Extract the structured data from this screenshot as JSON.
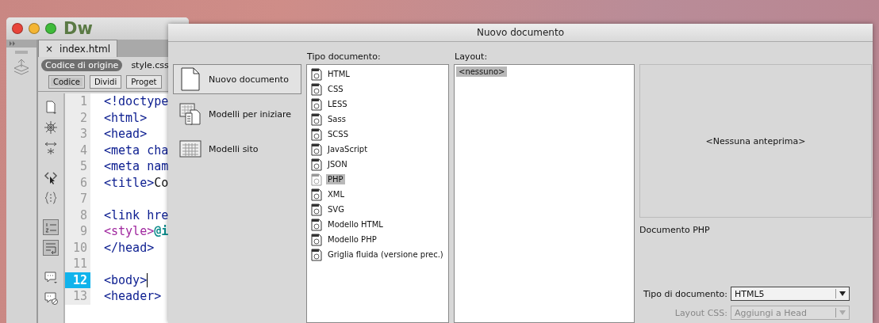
{
  "app": {
    "logo": "Dw",
    "tabs": [
      {
        "label": "index.html",
        "close": "×",
        "selected": true
      }
    ],
    "related_files": [
      {
        "label": "Codice di origine",
        "selected": true
      },
      {
        "label": "style.css",
        "selected": false
      }
    ],
    "view_buttons": [
      {
        "label": "Codice",
        "selected": true
      },
      {
        "label": "Dividi",
        "selected": false
      },
      {
        "label": "Proget",
        "selected": false
      }
    ],
    "code_toolbar": [
      [
        {
          "kind": "file",
          "on": false
        },
        {
          "kind": "web",
          "on": false
        },
        {
          "kind": "expand",
          "on": false
        }
      ],
      [
        {
          "kind": "tag",
          "on": false
        },
        {
          "kind": "braces",
          "on": false
        }
      ],
      [
        {
          "kind": "numbers",
          "on": true
        },
        {
          "kind": "wrap",
          "on": true
        }
      ],
      [
        {
          "kind": "comment",
          "on": false
        },
        {
          "kind": "uncomment",
          "on": false
        }
      ]
    ],
    "code_lines": [
      {
        "number": "1",
        "current": false,
        "segments": [
          {
            "kind": "tag",
            "text": "<!doctype"
          }
        ]
      },
      {
        "number": "2",
        "current": false,
        "segments": [
          {
            "kind": "tag",
            "text": "<html>"
          }
        ]
      },
      {
        "number": "3",
        "current": false,
        "segments": [
          {
            "kind": "tag",
            "text": "<head>"
          }
        ]
      },
      {
        "number": "4",
        "current": false,
        "segments": [
          {
            "kind": "tag",
            "text": "<meta cha"
          }
        ]
      },
      {
        "number": "5",
        "current": false,
        "segments": [
          {
            "kind": "tag",
            "text": "<meta nam"
          }
        ]
      },
      {
        "number": "6",
        "current": false,
        "segments": [
          {
            "kind": "tag",
            "text": "<title>"
          },
          {
            "kind": "text",
            "text": "Co"
          }
        ]
      },
      {
        "number": "7",
        "current": false
      },
      {
        "number": "8",
        "current": false,
        "segments": [
          {
            "kind": "tag",
            "text": "<link hre"
          }
        ]
      },
      {
        "number": "9",
        "current": false,
        "segments": [
          {
            "kind": "style",
            "text": "<style>"
          },
          {
            "kind": "rule",
            "text": "@i"
          }
        ]
      },
      {
        "number": "10",
        "current": false,
        "segments": [
          {
            "kind": "tag",
            "text": "</head>"
          }
        ]
      },
      {
        "number": "11",
        "current": false
      },
      {
        "number": "12",
        "current": true,
        "segments": [
          {
            "kind": "tag",
            "text": "<body>"
          }
        ]
      },
      {
        "number": "13",
        "current": false,
        "segments": [
          {
            "kind": "tag",
            "text": "<header>"
          }
        ]
      }
    ]
  },
  "dialog": {
    "title": "Nuovo documento",
    "categories": [
      {
        "kind": "page",
        "label": "Nuovo documento",
        "selected": true
      },
      {
        "kind": "templates",
        "label": "Modelli per iniziare",
        "selected": false
      },
      {
        "kind": "grid",
        "label": "Modelli sito",
        "selected": false
      }
    ],
    "doc_type": {
      "label": "Tipo documento:",
      "items": [
        {
          "label": "HTML",
          "selected": false
        },
        {
          "label": "CSS",
          "selected": false
        },
        {
          "label": "LESS",
          "selected": false
        },
        {
          "label": "Sass",
          "selected": false
        },
        {
          "label": "SCSS",
          "selected": false
        },
        {
          "label": "JavaScript",
          "selected": false
        },
        {
          "label": "JSON",
          "selected": false
        },
        {
          "label": "PHP",
          "selected": true
        },
        {
          "label": "XML",
          "selected": false
        },
        {
          "label": "SVG",
          "selected": false
        },
        {
          "label": "Modello HTML",
          "selected": false
        },
        {
          "label": "Modello PHP",
          "selected": false
        },
        {
          "label": "Griglia fluida (versione prec.)",
          "selected": false
        }
      ]
    },
    "layout": {
      "label": "Layout:",
      "items": [
        {
          "label": "<nessuno>",
          "selected": true
        }
      ]
    },
    "preview": {
      "text": "<Nessuna anteprima>"
    },
    "description": "Documento PHP",
    "fields": [
      {
        "label": "Tipo di documento:",
        "value": "HTML5",
        "disabled": false
      },
      {
        "label": "Layout CSS:",
        "value": "Aggiungi a Head",
        "disabled": true
      }
    ]
  }
}
